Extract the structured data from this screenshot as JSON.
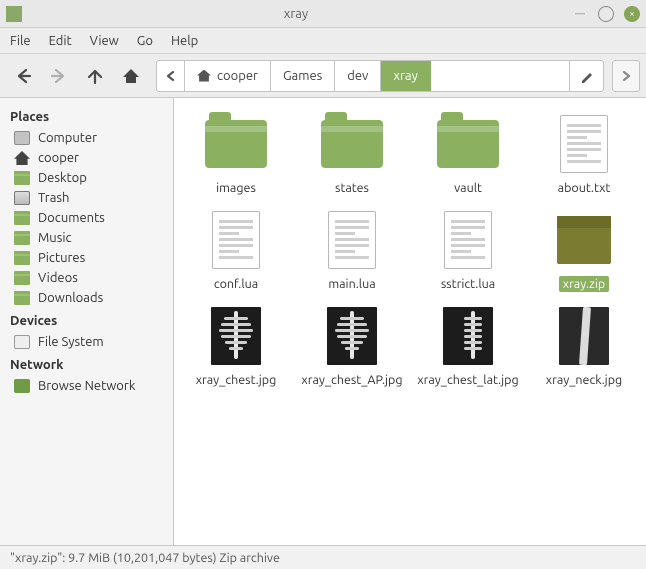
{
  "window": {
    "title": "xray"
  },
  "menu": {
    "file": "File",
    "edit": "Edit",
    "view": "View",
    "go": "Go",
    "help": "Help"
  },
  "breadcrumbs": {
    "root_label": "cooper",
    "items": [
      "Games",
      "dev",
      "xray"
    ],
    "active_index": 2
  },
  "sidebar": {
    "places_header": "Places",
    "devices_header": "Devices",
    "network_header": "Network",
    "places": [
      {
        "label": "Computer",
        "icon": "computer"
      },
      {
        "label": "cooper",
        "icon": "home"
      },
      {
        "label": "Desktop",
        "icon": "folder",
        "selected": false
      },
      {
        "label": "Trash",
        "icon": "trash"
      },
      {
        "label": "Documents",
        "icon": "folder"
      },
      {
        "label": "Music",
        "icon": "folder"
      },
      {
        "label": "Pictures",
        "icon": "folder"
      },
      {
        "label": "Videos",
        "icon": "folder"
      },
      {
        "label": "Downloads",
        "icon": "folder"
      }
    ],
    "devices": [
      {
        "label": "File System",
        "icon": "disk"
      }
    ],
    "network": [
      {
        "label": "Browse Network",
        "icon": "net"
      }
    ]
  },
  "files": [
    {
      "name": "images",
      "type": "folder"
    },
    {
      "name": "states",
      "type": "folder"
    },
    {
      "name": "vault",
      "type": "folder"
    },
    {
      "name": "about.txt",
      "type": "text"
    },
    {
      "name": "conf.lua",
      "type": "text"
    },
    {
      "name": "main.lua",
      "type": "text"
    },
    {
      "name": "sstrict.lua",
      "type": "text"
    },
    {
      "name": "xray.zip",
      "type": "archive",
      "selected": true
    },
    {
      "name": "xray_chest.jpg",
      "type": "xray"
    },
    {
      "name": "xray_chest_AP.jpg",
      "type": "xray"
    },
    {
      "name": "xray_chest_lat.jpg",
      "type": "xray-lat"
    },
    {
      "name": "xray_neck.jpg",
      "type": "xray-neck"
    }
  ],
  "status": {
    "text": "\"xray.zip\": 9.7 MiB (10,201,047 bytes) Zip archive"
  }
}
